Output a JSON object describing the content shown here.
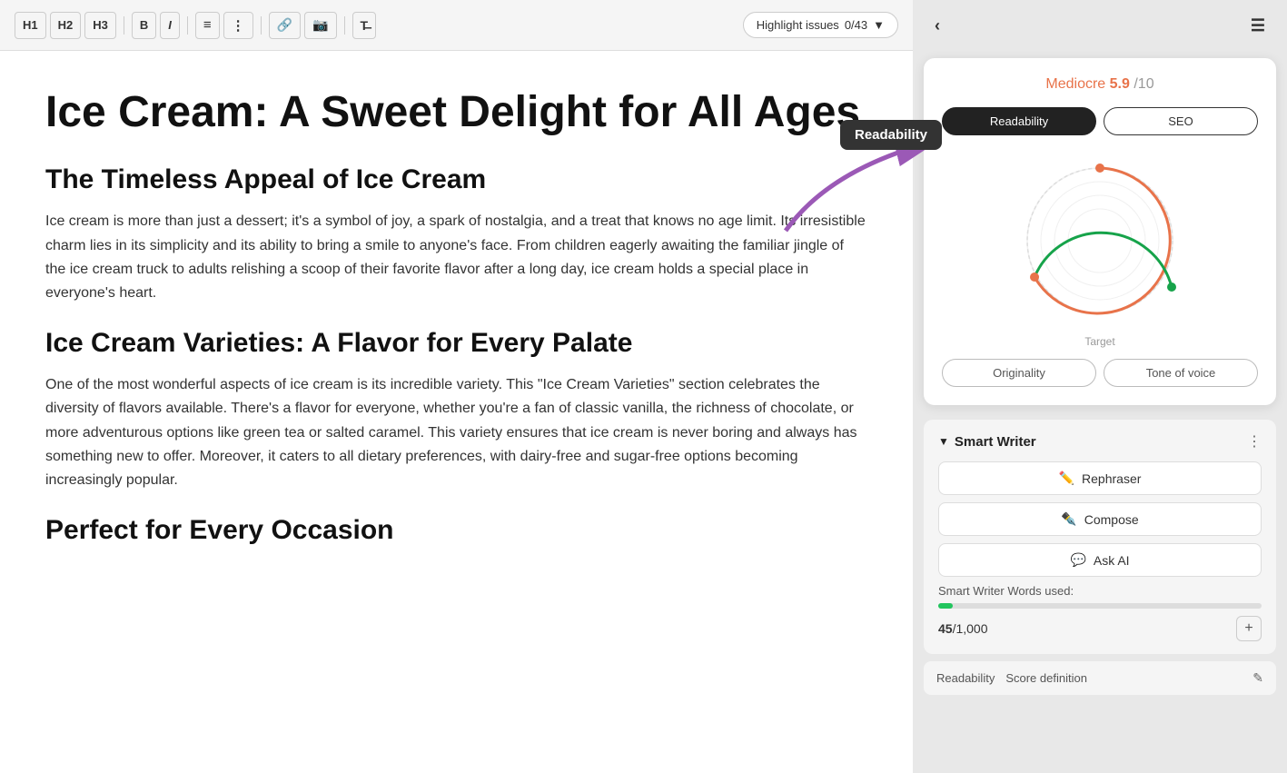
{
  "toolbar": {
    "h1_label": "H1",
    "h2_label": "H2",
    "h3_label": "H3",
    "bold_label": "B",
    "italic_label": "I",
    "highlight_btn": "Highlight issues",
    "issues_count": "0/43"
  },
  "content": {
    "title": "Ice Cream: A Sweet Delight for All Ages",
    "section1_heading": "The Timeless Appeal of Ice Cream",
    "section1_para": "Ice cream is more than just a dessert; it's a symbol of joy, a spark of nostalgia, and a treat that knows no age limit. Its irresistible charm lies in its simplicity and its ability to bring a smile to anyone's face. From children eagerly awaiting the familiar jingle of the ice cream truck to adults relishing a scoop of their favorite flavor after a long day, ice cream holds a special place in everyone's heart.",
    "section2_heading": "Ice Cream Varieties: A Flavor for Every Palate",
    "section2_para": "One of the most wonderful aspects of ice cream is its incredible variety. This \"Ice Cream Varieties\" section celebrates the diversity of flavors available. There's a flavor for everyone, whether you're a fan of classic vanilla, the richness of chocolate, or more adventurous options like green tea or salted caramel. This variety ensures that ice cream is never boring and always has something new to offer. Moreover, it caters to all dietary preferences, with dairy-free and sugar-free options becoming increasingly popular.",
    "section3_heading": "Perfect for Every Occasion"
  },
  "sidebar": {
    "score_label": "Mediocre",
    "score_value": "5.9",
    "score_max": "/10",
    "tab_readability": "Readability",
    "tab_seo": "SEO",
    "target_label": "Target",
    "btn_originality": "Originality",
    "btn_tone_of_voice": "Tone of voice",
    "readability_tooltip": "Readability",
    "smart_writer_title": "Smart Writer",
    "btn_rephraser": "Rephraser",
    "btn_compose": "Compose",
    "btn_ask_ai": "Ask AI",
    "words_used_label": "Smart Writer Words used:",
    "words_used": "45",
    "words_total": "1,000",
    "footer_readability": "Readability",
    "footer_score_def": "Score definition"
  },
  "chart": {
    "orange_arc_start": 45,
    "orange_arc_end": 210,
    "green_arc_start": 210,
    "green_arc_end": 355,
    "dot_orange_angle": 205,
    "dot_green_angle": 350
  }
}
